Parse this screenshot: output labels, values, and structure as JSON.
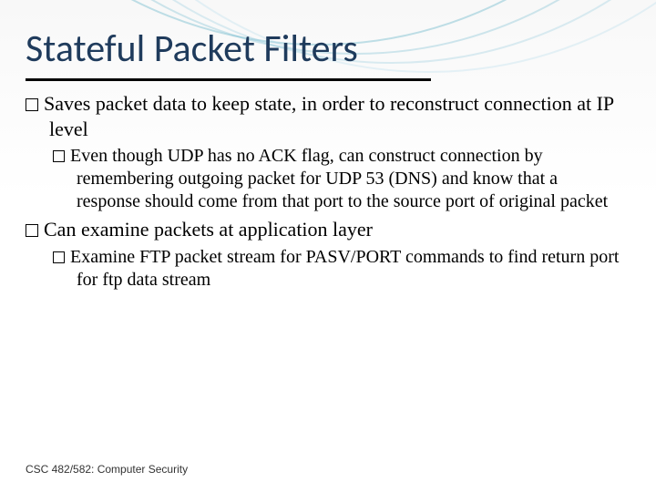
{
  "title": "Stateful Packet Filters",
  "bullets": {
    "b1a": "Saves packet data to keep state, in order to reconstruct connection at IP level",
    "b1a_sub": "Even though UDP has no ACK flag, can construct connection by remembering outgoing packet for UDP 53 (DNS) and know that a response should come from that port to the source port of original packet",
    "b1b": "Can examine packets at application layer",
    "b1b_sub": "Examine FTP packet stream for PASV/PORT commands to find return port for ftp data stream"
  },
  "footer": "CSC 482/582: Computer Security"
}
